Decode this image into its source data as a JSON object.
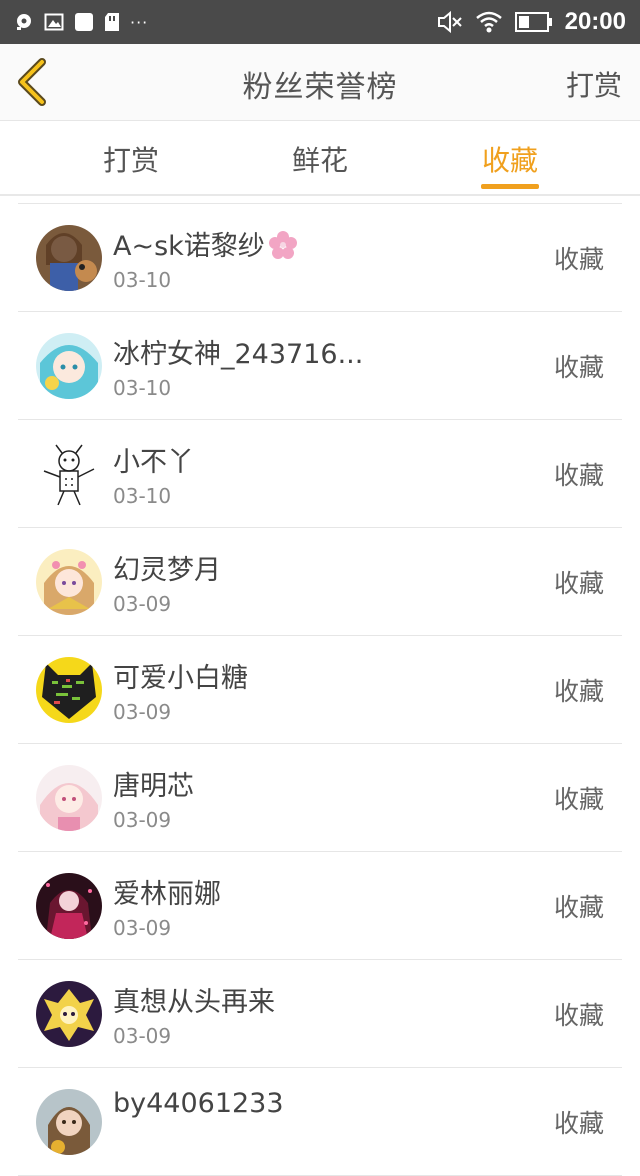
{
  "status_bar": {
    "time": "20:00",
    "overflow": "···",
    "left_icons": [
      "notification-icon",
      "image-icon",
      "app-icon",
      "sdcard-icon"
    ],
    "right_icons": [
      "mute-icon",
      "wifi-icon",
      "battery-icon"
    ]
  },
  "header": {
    "title": "粉丝荣誉榜",
    "action_label": "打赏",
    "back_icon": "chevron-left-icon",
    "accent_color": "#f0a01e"
  },
  "tabs": [
    {
      "label": "打赏",
      "active": false
    },
    {
      "label": "鲜花",
      "active": false
    },
    {
      "label": "收藏",
      "active": true
    }
  ],
  "list": [
    {
      "name": "A~sk诺黎纱",
      "date": "03-10",
      "type": "收藏",
      "badge": "flower-icon"
    },
    {
      "name": "冰柠女神_243716...",
      "date": "03-10",
      "type": "收藏"
    },
    {
      "name": "小不丫",
      "date": "03-10",
      "type": "收藏"
    },
    {
      "name": "幻灵梦月",
      "date": "03-09",
      "type": "收藏"
    },
    {
      "name": "可爱小白糖",
      "date": "03-09",
      "type": "收藏"
    },
    {
      "name": "唐明芯",
      "date": "03-09",
      "type": "收藏"
    },
    {
      "name": "爱林丽娜",
      "date": "03-09",
      "type": "收藏"
    },
    {
      "name": "真想从头再来",
      "date": "03-09",
      "type": "收藏"
    },
    {
      "name": "by44061233",
      "date": "",
      "type": "收藏"
    }
  ]
}
